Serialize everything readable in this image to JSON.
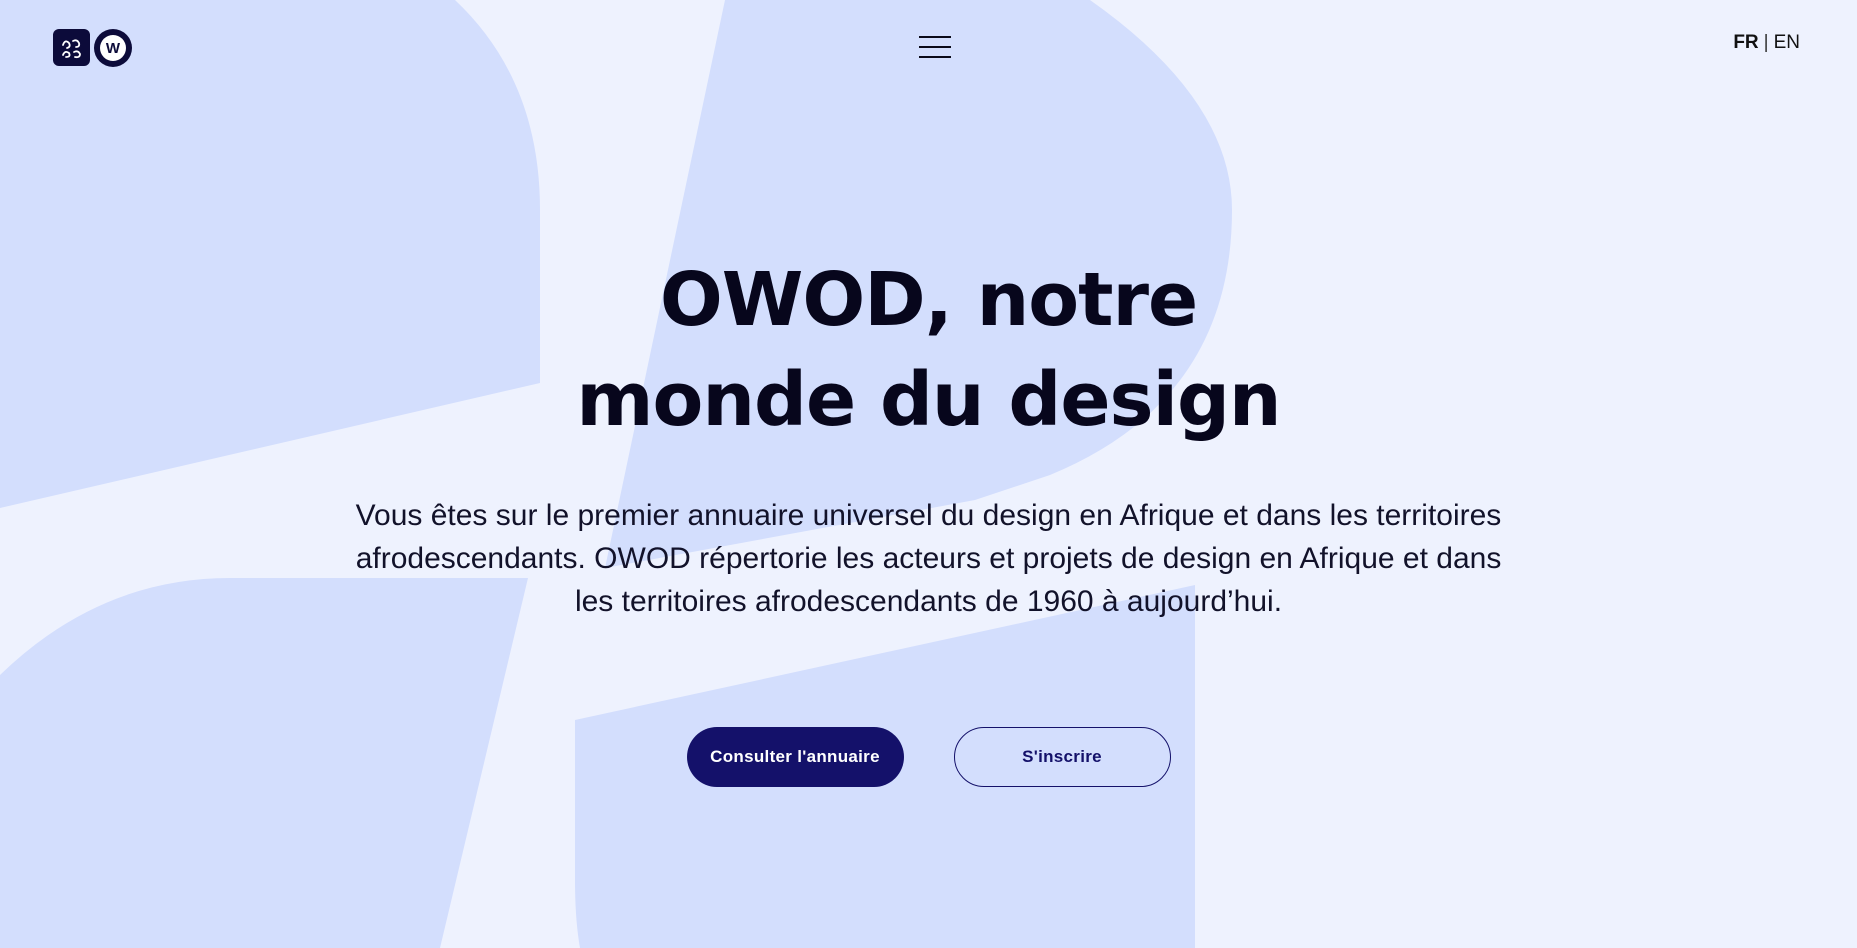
{
  "header": {
    "logo_square_alt": "OWOD logo mark",
    "logo_circle_letter": "W",
    "menu_icon": "hamburger-menu-icon",
    "lang_fr": "FR",
    "lang_sep": "|",
    "lang_en": "EN"
  },
  "hero": {
    "title_line1": "OWOD, notre",
    "title_line2": "monde du design",
    "description": "Vous êtes sur le premier annuaire universel du design en Afrique et dans les territoires afrodescendants. OWOD répertorie les acteurs et projets de design en Afrique et dans les territoires afrodescendants de 1960 à aujourd’hui."
  },
  "actions": {
    "primary_label": "Consulter l'annuaire",
    "secondary_label": "S'inscrire"
  },
  "colors": {
    "background": "#eef2fe",
    "shape": "#d3defd",
    "primary": "#14116a",
    "text": "#07061c"
  }
}
